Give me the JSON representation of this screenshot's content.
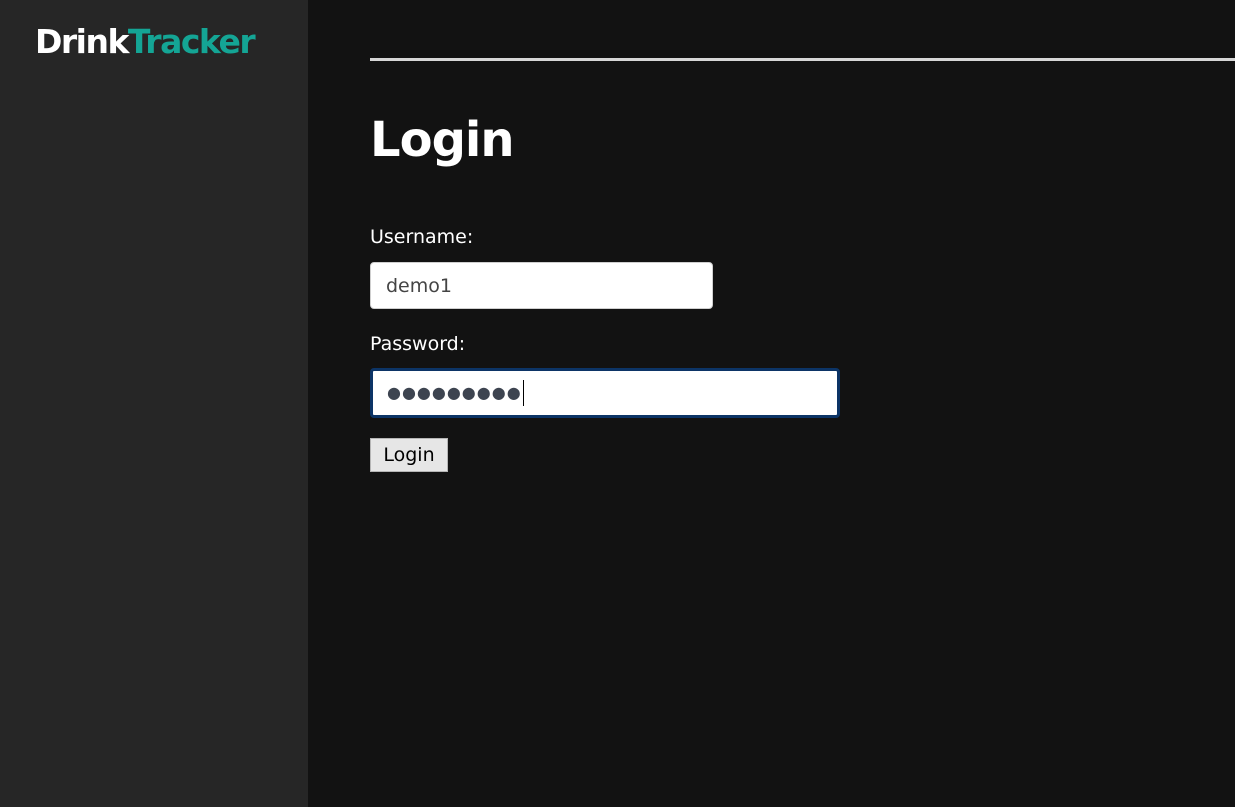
{
  "brand": {
    "first": "Drink",
    "second": "Tracker",
    "accent_color": "#14a595"
  },
  "page": {
    "title": "Login"
  },
  "form": {
    "username_label": "Username:",
    "username_value": "demo1",
    "password_label": "Password:",
    "password_masked": "●●●●●●●●●",
    "submit_label": "Login"
  },
  "colors": {
    "sidebar_bg": "#262626",
    "main_bg": "#121212",
    "focus_border": "#0c3466"
  }
}
